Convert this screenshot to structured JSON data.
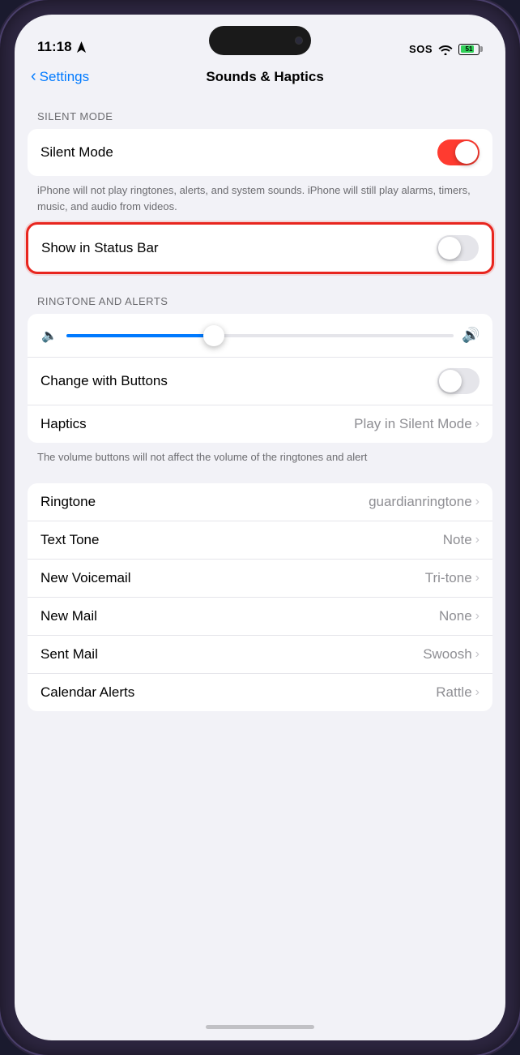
{
  "statusBar": {
    "time": "11:18",
    "sos": "SOS",
    "batteryLevel": "51"
  },
  "header": {
    "backLabel": "Settings",
    "title": "Sounds & Haptics"
  },
  "silentMode": {
    "sectionLabel": "SILENT MODE",
    "label": "Silent Mode",
    "isOn": true,
    "description": "iPhone will not play ringtones, alerts, and system sounds. iPhone will still play alarms, timers, music, and audio from videos."
  },
  "showInStatusBar": {
    "label": "Show in Status Bar",
    "isOn": false
  },
  "ringtoneAlerts": {
    "sectionLabel": "RINGTONE AND ALERTS",
    "sliderPercent": 38,
    "changeWithButtons": {
      "label": "Change with Buttons",
      "isOn": false
    },
    "haptics": {
      "label": "Haptics",
      "value": "Play in Silent Mode"
    },
    "description": "The volume buttons will not affect the volume of the ringtones and alert"
  },
  "soundList": [
    {
      "label": "Ringtone",
      "value": "guardianringtone"
    },
    {
      "label": "Text Tone",
      "value": "Note"
    },
    {
      "label": "New Voicemail",
      "value": "Tri-tone"
    },
    {
      "label": "New Mail",
      "value": "None"
    },
    {
      "label": "Sent Mail",
      "value": "Swoosh"
    },
    {
      "label": "Calendar Alerts",
      "value": "Rattle"
    }
  ]
}
